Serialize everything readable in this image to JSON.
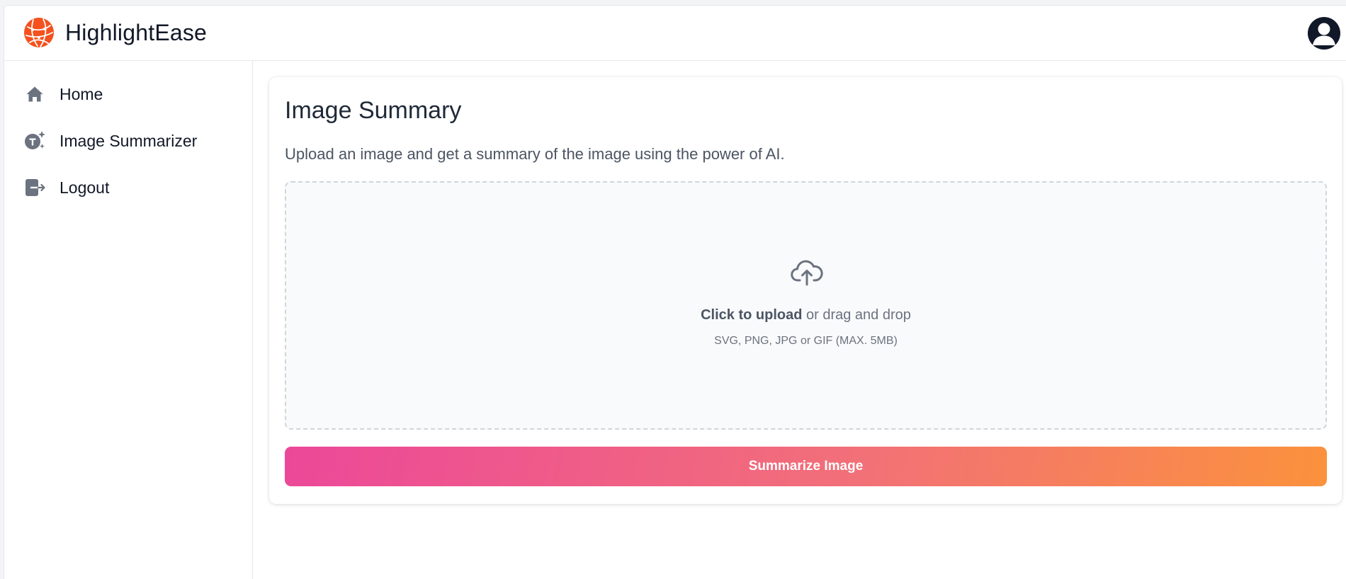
{
  "header": {
    "app_name": "HighlightEase",
    "logo_icon": "globe-logo-icon",
    "avatar_icon": "user-avatar-icon"
  },
  "sidebar": {
    "items": [
      {
        "label": "Home",
        "icon": "home-icon"
      },
      {
        "label": "Image Summarizer",
        "icon": "text-sparkle-icon"
      },
      {
        "label": "Logout",
        "icon": "logout-icon"
      }
    ]
  },
  "main": {
    "title": "Image Summary",
    "description": "Upload an image and get a summary of the image using the power of AI.",
    "dropzone": {
      "icon": "cloud-upload-icon",
      "click_text": "Click to upload",
      "drag_text": " or drag and drop",
      "hint": "SVG, PNG, JPG or GIF (MAX. 5MB)"
    },
    "button_label": "Summarize Image"
  },
  "colors": {
    "brand": "#f4511e",
    "gradient_start": "#ec4899",
    "gradient_end": "#fb923c",
    "icon_gray": "#6b7280"
  }
}
